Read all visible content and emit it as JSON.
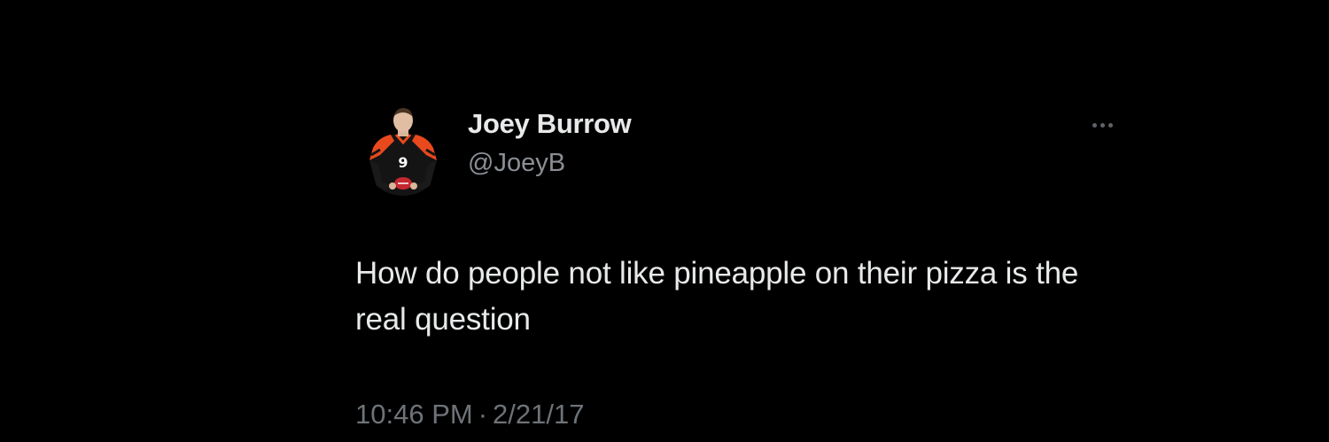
{
  "tweet": {
    "author": {
      "display_name": "Joey Burrow",
      "handle": "@JoeyB"
    },
    "more_icon": "ellipsis-horizontal-icon",
    "text": "How do people not like pineapple on their pizza is the real question",
    "time": "10:46 PM",
    "separator": "·",
    "date": "2/21/17"
  },
  "colors": {
    "background": "#000000",
    "primary_text": "#e7e9ea",
    "secondary_text": "#8b8f94",
    "jersey_orange": "#e8491d",
    "jersey_black": "#141414"
  }
}
